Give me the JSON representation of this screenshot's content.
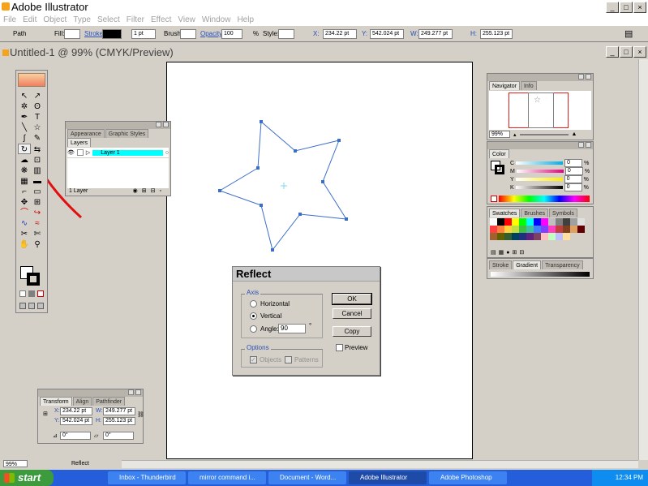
{
  "app": {
    "title": "Adobe Illustrator"
  },
  "menu": [
    "File",
    "Edit",
    "Object",
    "Type",
    "Select",
    "Filter",
    "Effect",
    "View",
    "Window",
    "Help"
  ],
  "control_bar": {
    "selection": "Path",
    "fill_label": "Fill:",
    "stroke_label": "Stroke:",
    "stroke_weight": "1 pt",
    "brush_label": "Brush:",
    "opacity_label": "Opacity:",
    "opacity_value": "100",
    "opacity_unit": "%",
    "style_label": "Style:",
    "x_label": "X:",
    "x_value": "234.22 pt",
    "y_label": "Y:",
    "y_value": "542.024 pt",
    "w_label": "W:",
    "w_value": "249.277 pt",
    "h_label": "H:",
    "h_value": "255.123 pt"
  },
  "document": {
    "title": "Untitled-1 @ 99% (CMYK/Preview)"
  },
  "status": {
    "zoom": "99%",
    "tool": "Reflect"
  },
  "layers_panel": {
    "tabs": [
      "Appearance",
      "Graphic Styles"
    ],
    "active_tab": "Layers",
    "layer_name": "Layer 1",
    "footer": "1 Layer"
  },
  "navigator_panel": {
    "tabs": [
      "Navigator",
      "Info"
    ],
    "zoom": "99%"
  },
  "color_panel": {
    "tab": "Color",
    "channels": [
      {
        "label": "C",
        "value": "0"
      },
      {
        "label": "M",
        "value": "0"
      },
      {
        "label": "Y",
        "value": "0"
      },
      {
        "label": "K",
        "value": "0"
      }
    ],
    "unit": "%"
  },
  "swatches_panel": {
    "tabs": [
      "Swatches",
      "Brushes",
      "Symbols"
    ]
  },
  "stroke_panel": {
    "tabs": [
      "Stroke",
      "Gradient",
      "Transparency"
    ]
  },
  "transform_panel": {
    "tabs": [
      "Transform",
      "Align",
      "Pathfinder"
    ],
    "x_label": "X:",
    "x_value": "234.22 pt",
    "w_label": "W:",
    "w_value": "249.277 pt",
    "y_label": "Y:",
    "y_value": "542.024 pt",
    "h_label": "H:",
    "h_value": "255.123 pt",
    "rotate_value": "0°",
    "shear_value": "0°"
  },
  "reflect_dialog": {
    "title": "Reflect",
    "axis_label": "Axis",
    "horizontal": "Horizontal",
    "vertical": "Vertical",
    "angle_label": "Angle:",
    "angle_value": "90",
    "degree": "°",
    "options_label": "Options",
    "objects": "Objects",
    "patterns": "Patterns",
    "ok": "OK",
    "cancel": "Cancel",
    "copy": "Copy",
    "preview": "Preview",
    "selected_axis": "Vertical"
  },
  "taskbar": {
    "start": "start",
    "tasks": [
      "Inbox - Thunderbird",
      "mirror command i...",
      "Document - Word...",
      "Adobe Illustrator",
      "Adobe Photoshop"
    ],
    "active_task": "Adobe Illustrator",
    "clock": "12:34 PM"
  },
  "colors": {
    "accent_layer": "#00ffff",
    "star_stroke": "#3b6ec8",
    "arrow": "#e01010",
    "taskbar": "#245edb",
    "start": "#3c9b3c"
  }
}
